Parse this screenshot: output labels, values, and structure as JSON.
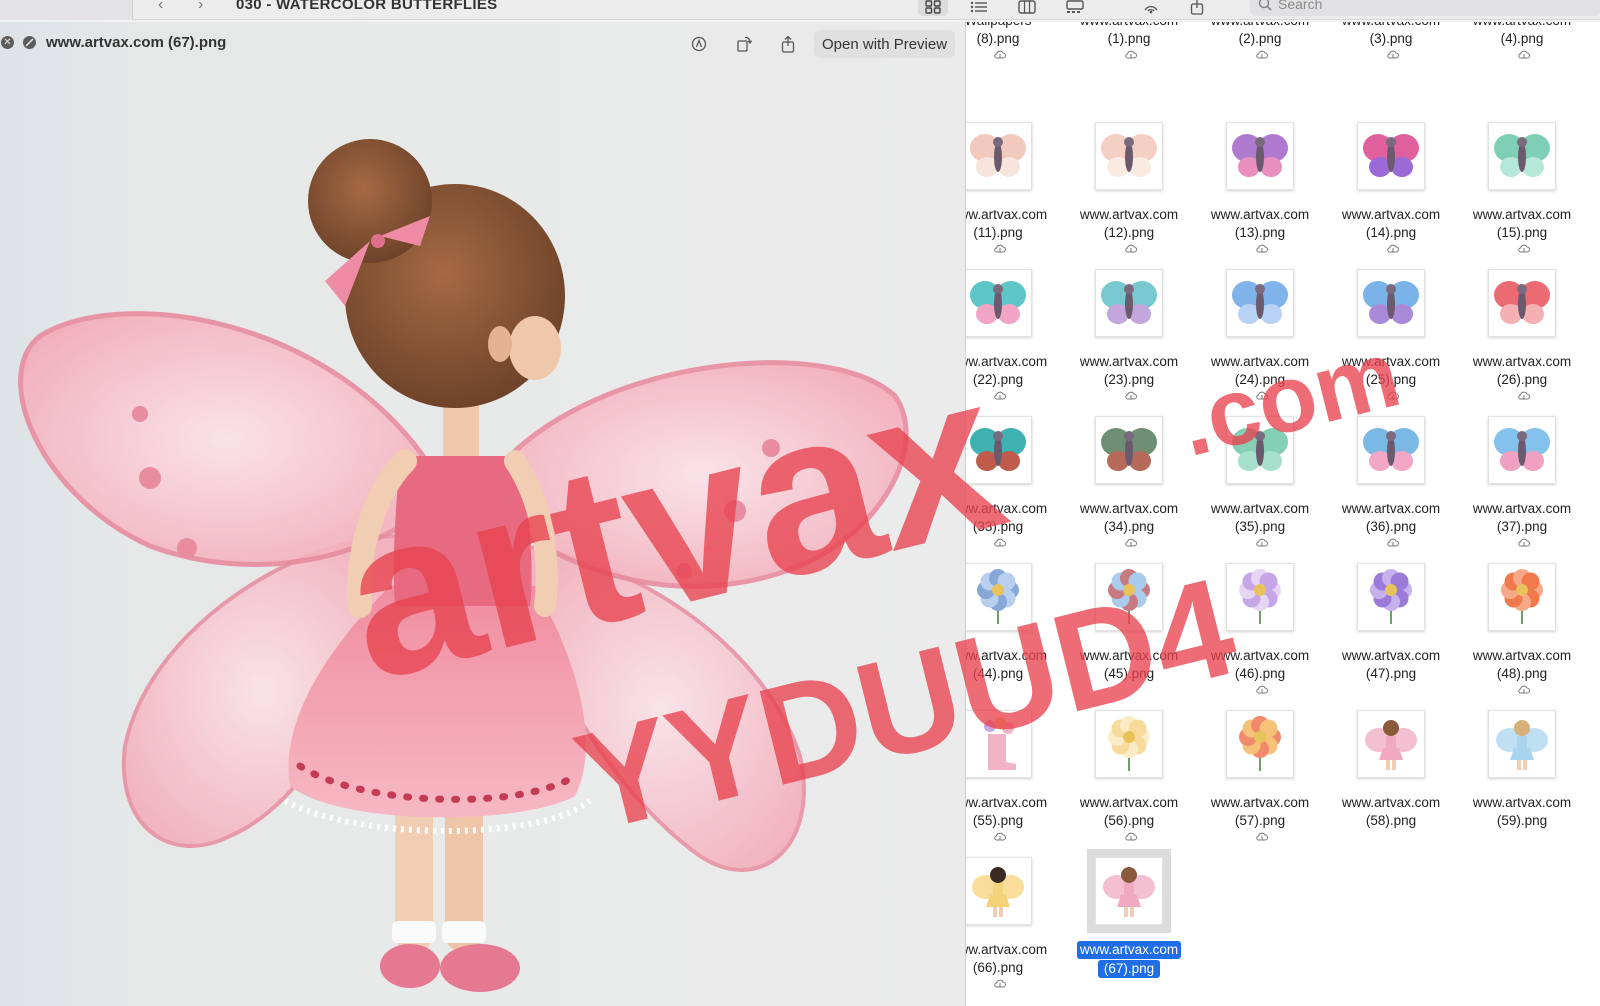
{
  "window": {
    "folder_title": "030 - WATERCOLOR BUTTERFLIES",
    "back_glyph": "‹",
    "forward_glyph": "›",
    "search_placeholder": "Search",
    "view_icons": [
      "grid-view-icon",
      "list-view-icon",
      "column-view-icon",
      "gallery-view-icon",
      "airdrop-icon",
      "share-icon"
    ]
  },
  "preview": {
    "title": "www.artvax.com (67).png",
    "open_with_label": "Open with Preview",
    "close_glyph": "✕",
    "fullscreen_glyph": "⤢",
    "icons": [
      "markup-icon",
      "rotate-icon",
      "share-icon"
    ]
  },
  "grid": {
    "items": [
      {
        "line1": "Wallpapers",
        "line2": "(8).png",
        "cloud": true,
        "thumb": "wallpaper"
      },
      {
        "line1": "www.artvax.com",
        "line2": "(1).png",
        "cloud": true,
        "thumb": "none"
      },
      {
        "line1": "www.artvax.com",
        "line2": "(2).png",
        "cloud": true,
        "thumb": "none"
      },
      {
        "line1": "www.artvax.com",
        "line2": "(3).png",
        "cloud": true,
        "thumb": "none"
      },
      {
        "line1": "www.artvax.com",
        "line2": "(4).png",
        "cloud": true,
        "thumb": "none"
      },
      {
        "line1": "www.artvax.com",
        "line2": "(11).png",
        "cloud": true,
        "thumb": "butterfly",
        "c1": "#f2c9bd",
        "c2": "#f7e4dc"
      },
      {
        "line1": "www.artvax.com",
        "line2": "(12).png",
        "cloud": true,
        "thumb": "butterfly",
        "c1": "#f4cfc4",
        "c2": "#faeae2"
      },
      {
        "line1": "www.artvax.com",
        "line2": "(13).png",
        "cloud": true,
        "thumb": "butterfly",
        "c1": "#b07ad0",
        "c2": "#e98fbf"
      },
      {
        "line1": "www.artvax.com",
        "line2": "(14).png",
        "cloud": true,
        "thumb": "butterfly",
        "c1": "#e0609e",
        "c2": "#9b6ad6"
      },
      {
        "line1": "www.artvax.com",
        "line2": "(15).png",
        "cloud": true,
        "thumb": "butterfly",
        "c1": "#7fcfb6",
        "c2": "#b5e8d8"
      },
      {
        "line1": "www.artvax.com",
        "line2": "(22).png",
        "cloud": true,
        "thumb": "butterfly",
        "c1": "#5cc6c9",
        "c2": "#f2a4c4"
      },
      {
        "line1": "www.artvax.com",
        "line2": "(23).png",
        "cloud": true,
        "thumb": "butterfly",
        "c1": "#78c9cf",
        "c2": "#c3a6dc"
      },
      {
        "line1": "www.artvax.com",
        "line2": "(24).png",
        "cloud": true,
        "thumb": "butterfly",
        "c1": "#7fb3ea",
        "c2": "#b7d2f5"
      },
      {
        "line1": "www.artvax.com",
        "line2": "(25).png",
        "cloud": true,
        "thumb": "butterfly",
        "c1": "#79b3e8",
        "c2": "#a98ad8"
      },
      {
        "line1": "www.artvax.com",
        "line2": "(26).png",
        "cloud": true,
        "thumb": "butterfly",
        "c1": "#ec6b72",
        "c2": "#f4b0b3"
      },
      {
        "line1": "www.artvax.com",
        "line2": "(33).png",
        "cloud": true,
        "thumb": "butterfly",
        "c1": "#3eb2b0",
        "c2": "#c05a4a"
      },
      {
        "line1": "www.artvax.com",
        "line2": "(34).png",
        "cloud": true,
        "thumb": "butterfly",
        "c1": "#6f8f74",
        "c2": "#b56a5a"
      },
      {
        "line1": "www.artvax.com",
        "line2": "(35).png",
        "cloud": true,
        "thumb": "butterfly",
        "c1": "#84cfb6",
        "c2": "#a6e0cc"
      },
      {
        "line1": "www.artvax.com",
        "line2": "(36).png",
        "cloud": true,
        "thumb": "butterfly",
        "c1": "#7ab9e6",
        "c2": "#f2a6c6"
      },
      {
        "line1": "www.artvax.com",
        "line2": "(37).png",
        "cloud": true,
        "thumb": "butterfly",
        "c1": "#84c1ec",
        "c2": "#f0a0c0"
      },
      {
        "line1": "www.artvax.com",
        "line2": "(44).png",
        "cloud": false,
        "thumb": "flower",
        "c1": "#b8cff0",
        "c2": "#86a8d8"
      },
      {
        "line1": "www.artvax.com",
        "line2": "(45).png",
        "cloud": false,
        "thumb": "flower",
        "c1": "#a9cbee",
        "c2": "#c77a80"
      },
      {
        "line1": "www.artvax.com",
        "line2": "(46).png",
        "cloud": true,
        "thumb": "flower",
        "c1": "#c6a6e6",
        "c2": "#e6d5f4"
      },
      {
        "line1": "www.artvax.com",
        "line2": "(47).png",
        "cloud": false,
        "thumb": "flower",
        "c1": "#9b7ad8",
        "c2": "#c6b0ee"
      },
      {
        "line1": "www.artvax.com",
        "line2": "(48).png",
        "cloud": true,
        "thumb": "flower",
        "c1": "#f07a4c",
        "c2": "#f6a888"
      },
      {
        "line1": "www.artvax.com",
        "line2": "(55).png",
        "cloud": true,
        "thumb": "boot",
        "c1": "#f2b3c6",
        "c2": "#c9a6e4"
      },
      {
        "line1": "www.artvax.com",
        "line2": "(56).png",
        "cloud": true,
        "thumb": "flower",
        "c1": "#f8db9a",
        "c2": "#fbecc8"
      },
      {
        "line1": "www.artvax.com",
        "line2": "(57).png",
        "cloud": true,
        "thumb": "flower",
        "c1": "#f6c27a",
        "c2": "#f08a6a"
      },
      {
        "line1": "www.artvax.com",
        "line2": "(58).png",
        "cloud": false,
        "thumb": "fairy",
        "c1": "#f0a9c0",
        "c2": "#8a5a3c"
      },
      {
        "line1": "www.artvax.com",
        "line2": "(59).png",
        "cloud": false,
        "thumb": "fairy",
        "c1": "#a9d4ee",
        "c2": "#d8b07a"
      },
      {
        "line1": "www.artvax.com",
        "line2": "(66).png",
        "cloud": true,
        "thumb": "fairy",
        "c1": "#f5d27a",
        "c2": "#3a2a22"
      },
      {
        "line1": "www.artvax.com",
        "line2": "(67).png",
        "cloud": false,
        "thumb": "fairy",
        "c1": "#f0a9c0",
        "c2": "#8a5a3c",
        "selected": true
      }
    ]
  },
  "watermark": {
    "line1": "artvax",
    "line2": ".com",
    "line3": "YYDUUD4",
    "color": "#e8434f"
  },
  "colors": {
    "selection": "#1f6ee8",
    "wing_pink": "#f4a9b8",
    "dress_pink": "#e9788b"
  }
}
